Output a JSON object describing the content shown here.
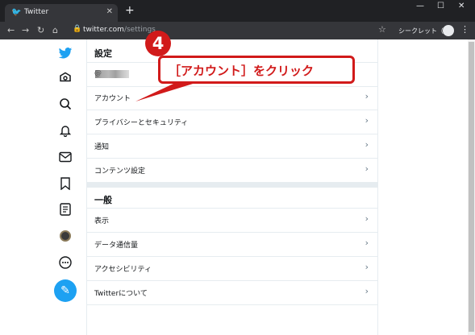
{
  "browser": {
    "tab_title": "Twitter",
    "url_host": "twitter.com",
    "url_path": "/settings",
    "incognito_label": "シークレット（2）"
  },
  "settings": {
    "heading": "設定",
    "username_prefix": "@",
    "account_rows": [
      {
        "label": "アカウント"
      },
      {
        "label": "プライバシーとセキュリティ"
      },
      {
        "label": "通知"
      },
      {
        "label": "コンテンツ設定"
      }
    ],
    "general_heading": "一般",
    "general_rows": [
      {
        "label": "表示"
      },
      {
        "label": "データ通信量"
      },
      {
        "label": "アクセシビリティ"
      },
      {
        "label": "Twitterについて"
      }
    ]
  },
  "annotation": {
    "step_number": "4",
    "callout_text": "［アカウント］をクリック",
    "color": "#d11a1a"
  },
  "colors": {
    "brand": "#1da1f2",
    "chrome_dark": "#202124",
    "border": "#e6ecf0"
  },
  "icons": [
    "twitter-logo-icon",
    "home-icon",
    "search-icon",
    "bell-icon",
    "mail-icon",
    "bookmark-icon",
    "list-icon",
    "avatar",
    "more-icon",
    "compose-icon"
  ]
}
